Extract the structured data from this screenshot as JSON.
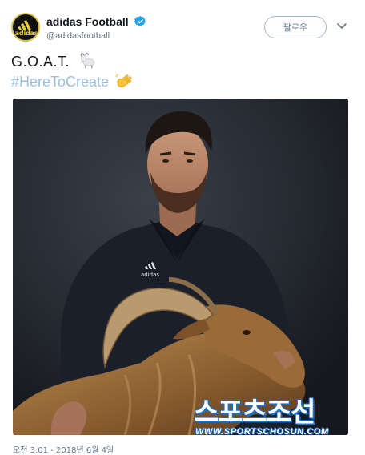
{
  "account": {
    "display_name": "adidas Football",
    "handle": "@adidasfootball",
    "avatar_text": "adidas",
    "verified": true
  },
  "follow_button": {
    "label": "팔로우"
  },
  "tweet": {
    "text": "G.O.A.T.",
    "hashtag": "#HereToCreate"
  },
  "photo": {
    "watermark": "스포츠조선",
    "watermark_url": "WWW.SPORTSCHOSUN.COM",
    "shirt_logo": "adidas"
  },
  "timestamp": "오전 3:01 - 2018년 6월 4일",
  "colors": {
    "link": "#9bbfe0",
    "verified": "#1da1f2",
    "muted": "#657786",
    "avatar_ring": "#d8c24a"
  },
  "icons": {
    "verified": "verified-badge-icon",
    "menu": "chevron-down-icon",
    "goat": "goat-emoji",
    "wave": "wave-emoji"
  }
}
